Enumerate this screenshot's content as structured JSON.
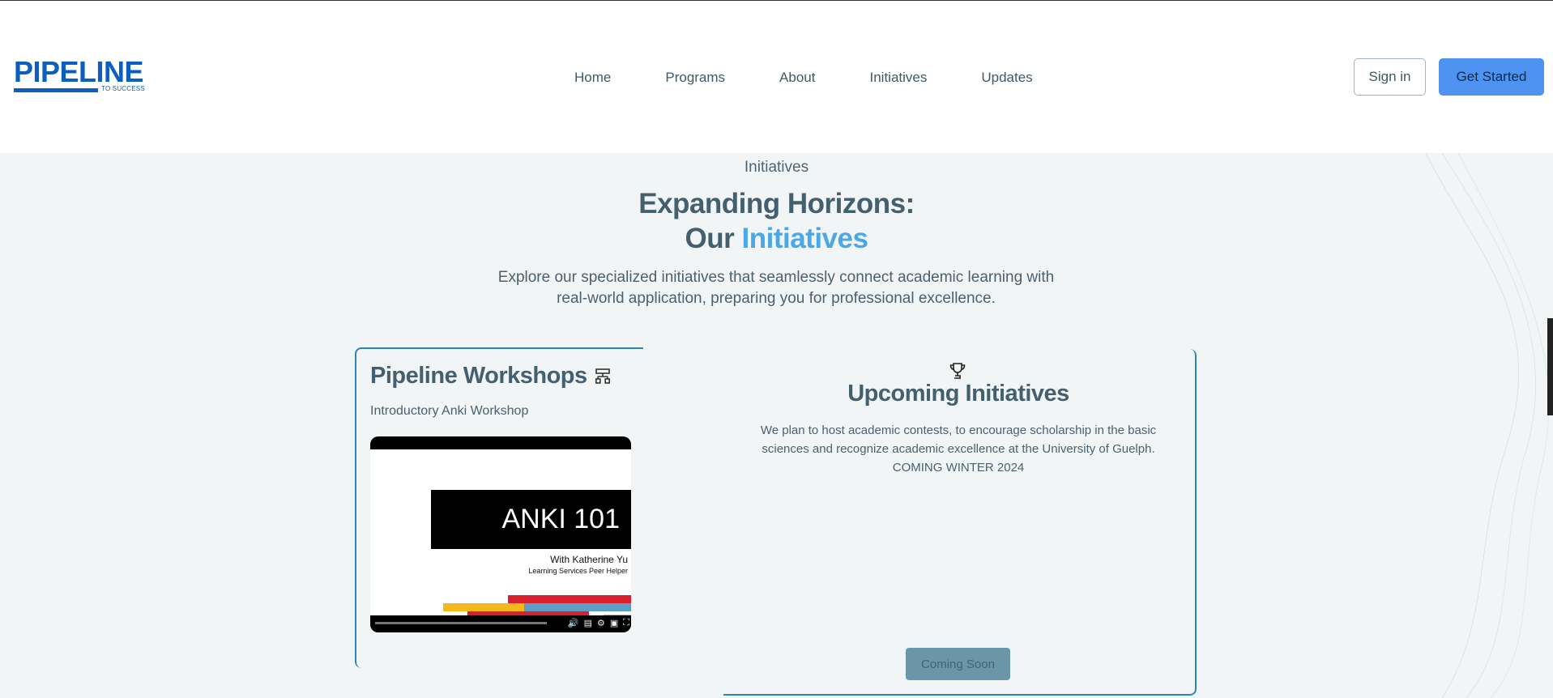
{
  "header": {
    "logo": {
      "word": "PIPELINE",
      "sub": "TO SUCCESS"
    },
    "nav": [
      "Home",
      "Programs",
      "About",
      "Initiatives",
      "Updates"
    ],
    "signin_label": "Sign in",
    "get_started_label": "Get Started"
  },
  "hero": {
    "eyebrow": "Initiatives",
    "title_line1": "Expanding Horizons:",
    "title_line2_plain": "Our",
    "title_line2_accent": "Initiatives",
    "subtitle": "Explore our specialized initiatives that seamlessly connect academic learning with real-world application, preparing you for professional excellence."
  },
  "workshops": {
    "title": "Pipeline Workshops",
    "subtitle": "Introductory Anki Workshop",
    "title_icon": "sitemap-icon",
    "video": {
      "slide_title": "ANKI 101",
      "author": "With Katherine Yu",
      "role": "Learning Services Peer Helper"
    }
  },
  "upcoming": {
    "icon": "trophy-icon",
    "title": "Upcoming Initiatives",
    "body": "We plan to host academic contests, to encourage scholarship in the basic sciences and recognize academic excellence at the University of Guelph. COMING WINTER 2024",
    "button_label": "Coming Soon"
  },
  "colors": {
    "accent": "#4aa8e6",
    "primary_button": "#4d93ef",
    "card_border": "#2d86b8",
    "background": "#f1f5f5"
  }
}
